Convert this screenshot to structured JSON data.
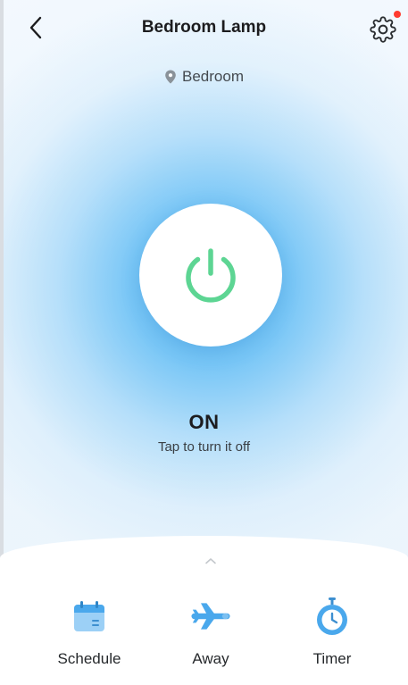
{
  "header": {
    "title": "Bedroom Lamp",
    "has_notification": true
  },
  "location": {
    "label": "Bedroom"
  },
  "power": {
    "state": "ON",
    "hint": "Tap to turn it off"
  },
  "features": [
    {
      "label": "Schedule",
      "icon": "calendar-icon"
    },
    {
      "label": "Away",
      "icon": "airplane-icon"
    },
    {
      "label": "Timer",
      "icon": "stopwatch-icon"
    }
  ],
  "colors": {
    "power_on": "#5dd593",
    "accent_blue": "#4aa8ec",
    "notification": "#ff3b30"
  }
}
